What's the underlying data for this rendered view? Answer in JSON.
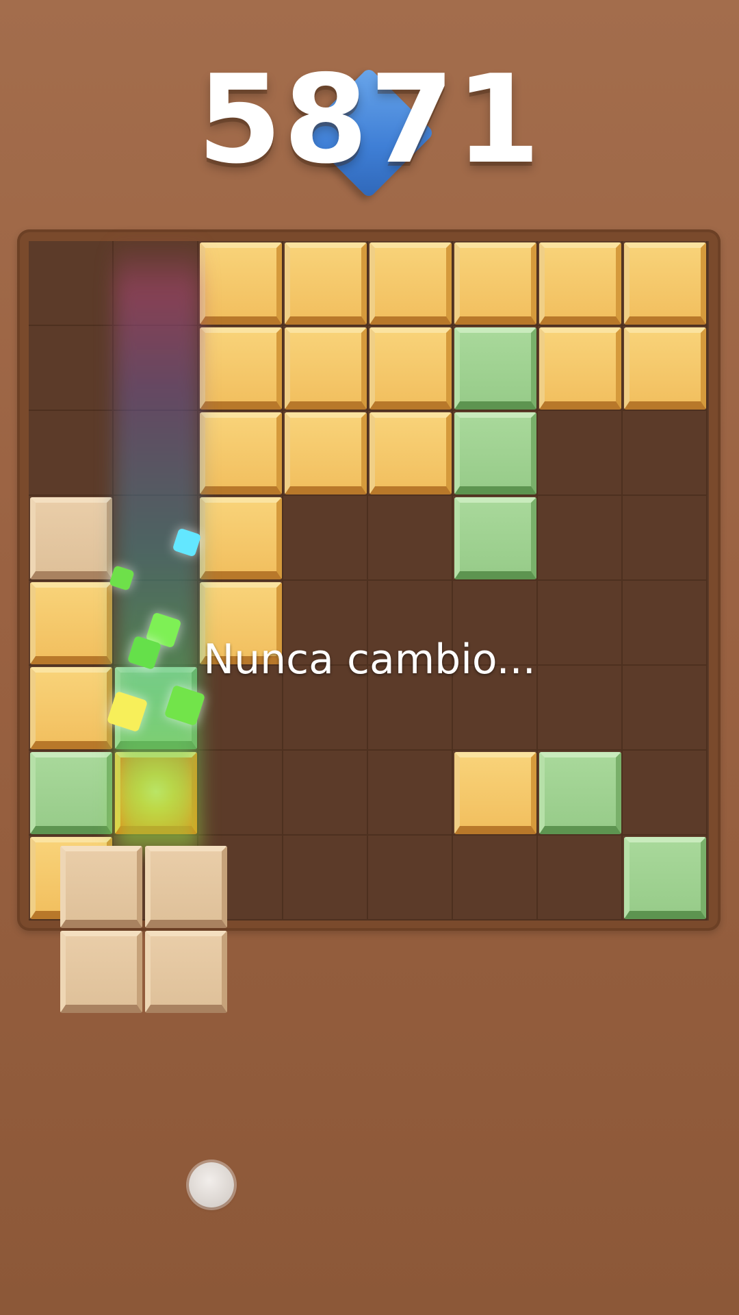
{
  "score": {
    "value": "5871"
  },
  "caption": {
    "text": "Nunca cambio..."
  },
  "colors": {
    "background": "#a36d4c",
    "board": "#5c3b29",
    "gold_block": "#f2c060",
    "green_block": "#98cc8a",
    "beige_block": "#dfc19a",
    "score_diamond": "#3f7fd6"
  },
  "board": {
    "rows": 8,
    "cols": 8,
    "cells": [
      [
        "empty",
        "empty",
        "gold",
        "gold",
        "gold",
        "gold",
        "gold",
        "gold"
      ],
      [
        "empty",
        "empty",
        "gold",
        "gold",
        "gold",
        "green",
        "gold",
        "gold"
      ],
      [
        "empty",
        "empty",
        "gold",
        "gold",
        "gold",
        "green",
        "empty",
        "empty"
      ],
      [
        "beige",
        "empty",
        "gold",
        "empty",
        "empty",
        "green",
        "empty",
        "empty"
      ],
      [
        "gold",
        "empty",
        "gold",
        "empty",
        "empty",
        "empty",
        "empty",
        "empty"
      ],
      [
        "gold",
        "green",
        "empty",
        "empty",
        "empty",
        "empty",
        "empty",
        "empty"
      ],
      [
        "green",
        "hot",
        "empty",
        "empty",
        "empty",
        "gold",
        "green",
        "empty"
      ],
      [
        "gold",
        "empty",
        "empty",
        "empty",
        "empty",
        "empty",
        "empty",
        "green"
      ]
    ]
  },
  "dragging_piece": {
    "shape": "2x2 square",
    "color": "beige",
    "cells": [
      [
        1,
        1
      ],
      [
        1,
        1
      ]
    ]
  }
}
